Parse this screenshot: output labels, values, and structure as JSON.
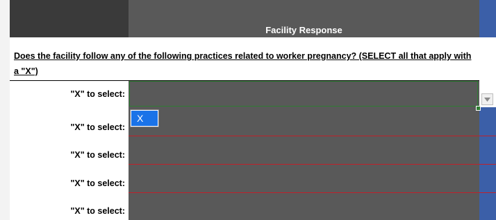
{
  "header": {
    "column_title": "Facility Response"
  },
  "question": {
    "text": "Does the facility follow any of the following practices related to worker pregnancy? (SELECT all that apply with a \"X\")"
  },
  "rows": [
    {
      "label": "\"X\" to select:"
    },
    {
      "label": "\"X\" to select:"
    },
    {
      "label": "\"X\" to select:"
    },
    {
      "label": "\"X\" to select:"
    },
    {
      "label": "\"X\" to select:"
    }
  ],
  "dropdown": {
    "icon": "chevron-down-icon",
    "options": [
      "X"
    ],
    "highlighted": "X"
  },
  "colors": {
    "header_dark": "#3a3a3a",
    "header_mid": "#595959",
    "accent_blue": "#3b5fa8",
    "row_border_red": "#c0202a",
    "selection_green": "#2e7d32",
    "option_highlight": "#1a73e8"
  }
}
